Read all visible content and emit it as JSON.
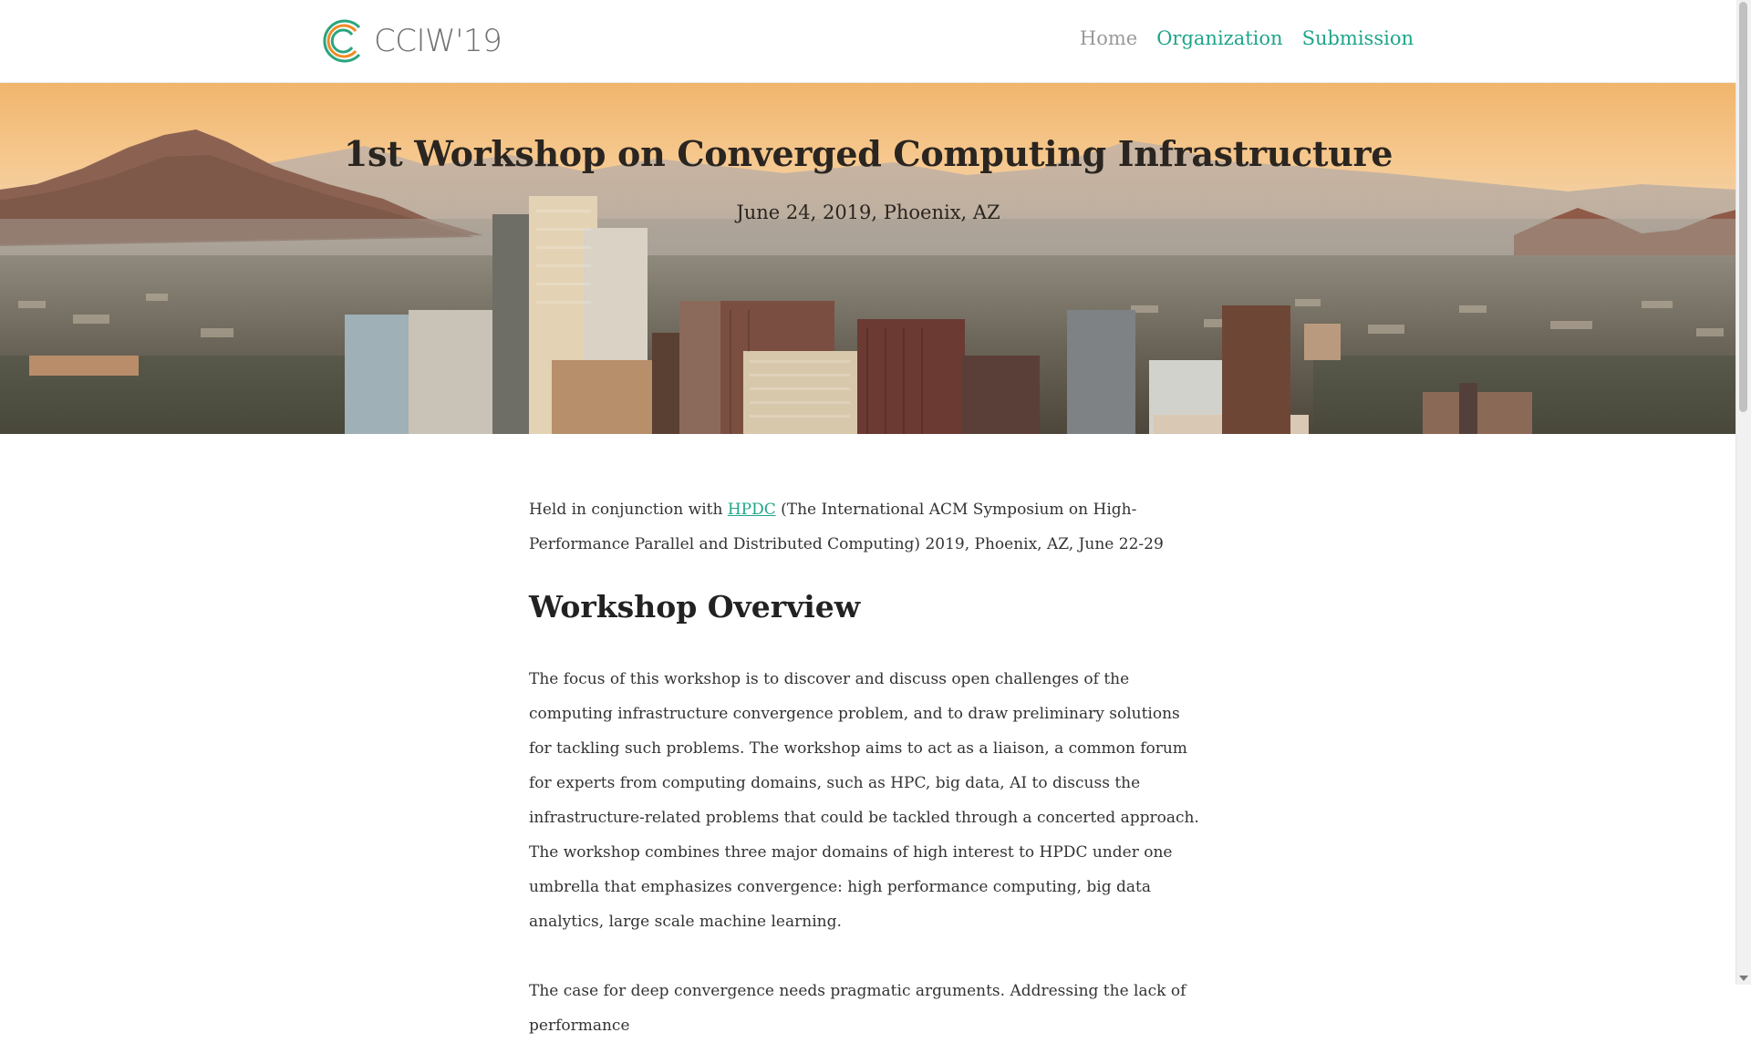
{
  "header": {
    "logo_text": "CCIW'19",
    "nav": [
      {
        "label": "Home"
      },
      {
        "label": "Organization"
      },
      {
        "label": "Submission"
      }
    ]
  },
  "hero": {
    "title": "1st Workshop on Converged Computing Infrastructure",
    "subtitle": "June 24, 2019, Phoenix, AZ"
  },
  "content": {
    "intro_before": "Held in conjunction with ",
    "intro_link": "HPDC",
    "intro_after": " (The International ACM Symposium on High-Performance Parallel and Distributed Computing) 2019, Phoenix, AZ, June 22-29",
    "heading": "Workshop Overview",
    "paragraph1": "The focus of this workshop is to discover and discuss open challenges of the computing infrastructure convergence problem, and to draw preliminary solutions for tackling such problems. The workshop aims to act as a liaison, a common forum for experts from computing domains, such as HPC, big data, AI to discuss the infrastructure-related problems that could be tackled through a concerted approach. The workshop combines three major domains of high interest to HPDC under one umbrella that emphasizes convergence: high performance computing, big data analytics, large scale machine learning.",
    "paragraph2": "The case for deep convergence needs pragmatic arguments. Addressing the lack of performance"
  },
  "colors": {
    "accent": "#1fa58a",
    "nav_muted": "#9a9a9a",
    "logo_green": "#2aa57f",
    "logo_orange": "#f08a24"
  }
}
